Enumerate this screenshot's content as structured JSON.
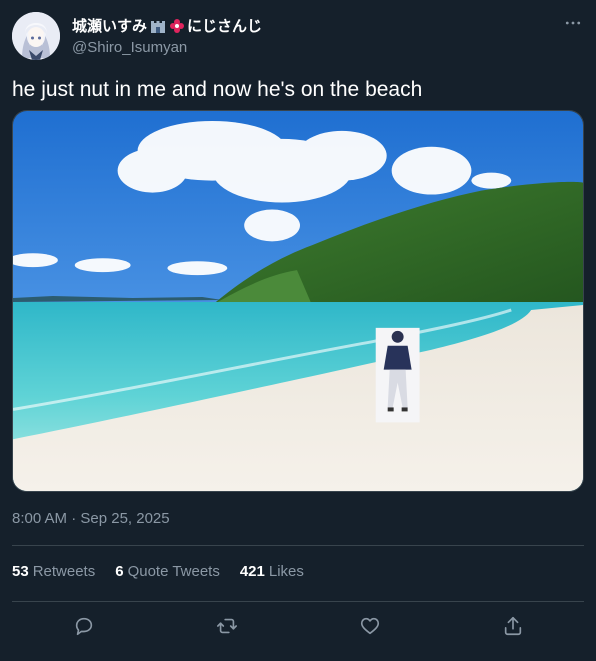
{
  "author": {
    "display_name": "城瀬いすみ",
    "display_name_suffix": "にじさんじ",
    "handle": "@Shiro_Isumyan",
    "icons": [
      "castle-emoji-icon",
      "flower-emoji-icon"
    ]
  },
  "tweet": {
    "text": "he just nut in me and now he's on the beach",
    "timestamp": "8:00 AM · Sep 25, 2025",
    "media": "beach-photo"
  },
  "stats": {
    "retweets_count": "53",
    "retweets_label": "Retweets",
    "quotes_count": "6",
    "quotes_label": "Quote Tweets",
    "likes_count": "421",
    "likes_label": "Likes"
  },
  "actions": [
    "reply-icon",
    "retweet-icon",
    "like-icon",
    "share-icon"
  ],
  "colors": {
    "background": "#15202b",
    "text_primary": "#ffffff",
    "text_secondary": "#8b98a5",
    "divider": "#38444d"
  }
}
